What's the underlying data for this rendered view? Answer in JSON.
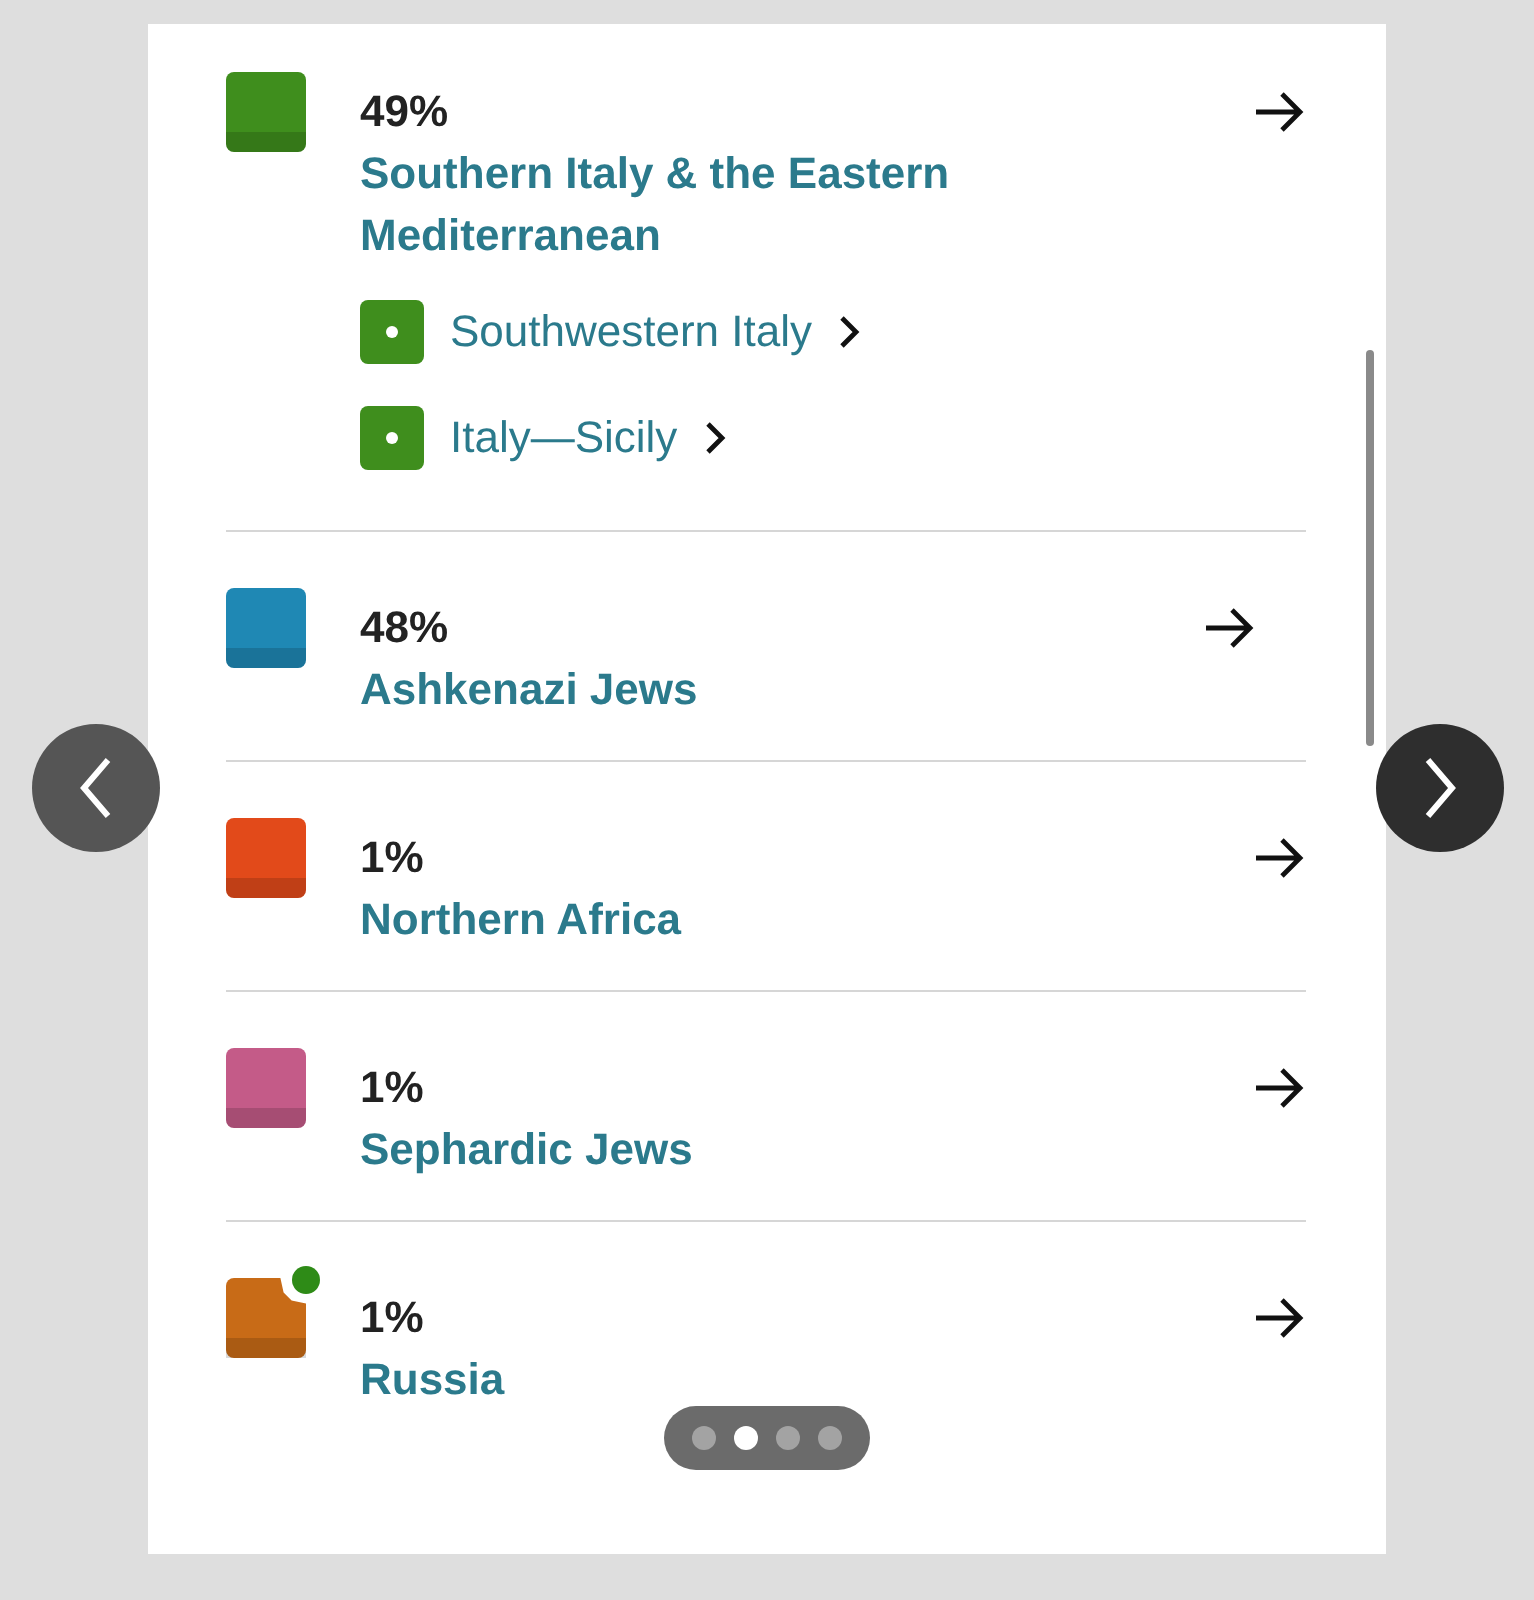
{
  "regions": [
    {
      "percent": "49%",
      "name": "Southern Italy & the Eastern Mediterranean",
      "color": "#3f8e1d",
      "new_dot": false,
      "children": [
        {
          "name": "Southwestern Italy",
          "color": "#3f8e1d"
        },
        {
          "name": "Italy—Sicily",
          "color": "#3f8e1d"
        }
      ]
    },
    {
      "percent": "48%",
      "name": "Ashkenazi Jews",
      "color": "#1f88b4",
      "new_dot": false
    },
    {
      "percent": "1%",
      "name": "Northern Africa",
      "color": "#e24a1a",
      "new_dot": false
    },
    {
      "percent": "1%",
      "name": "Sephardic Jews",
      "color": "#c45b88",
      "new_dot": false
    },
    {
      "percent": "1%",
      "name": "Russia",
      "color": "#c86b17",
      "new_dot": true
    }
  ],
  "pager": [
    {
      "selected": false
    },
    {
      "selected": true
    },
    {
      "selected": false
    },
    {
      "selected": false
    }
  ]
}
